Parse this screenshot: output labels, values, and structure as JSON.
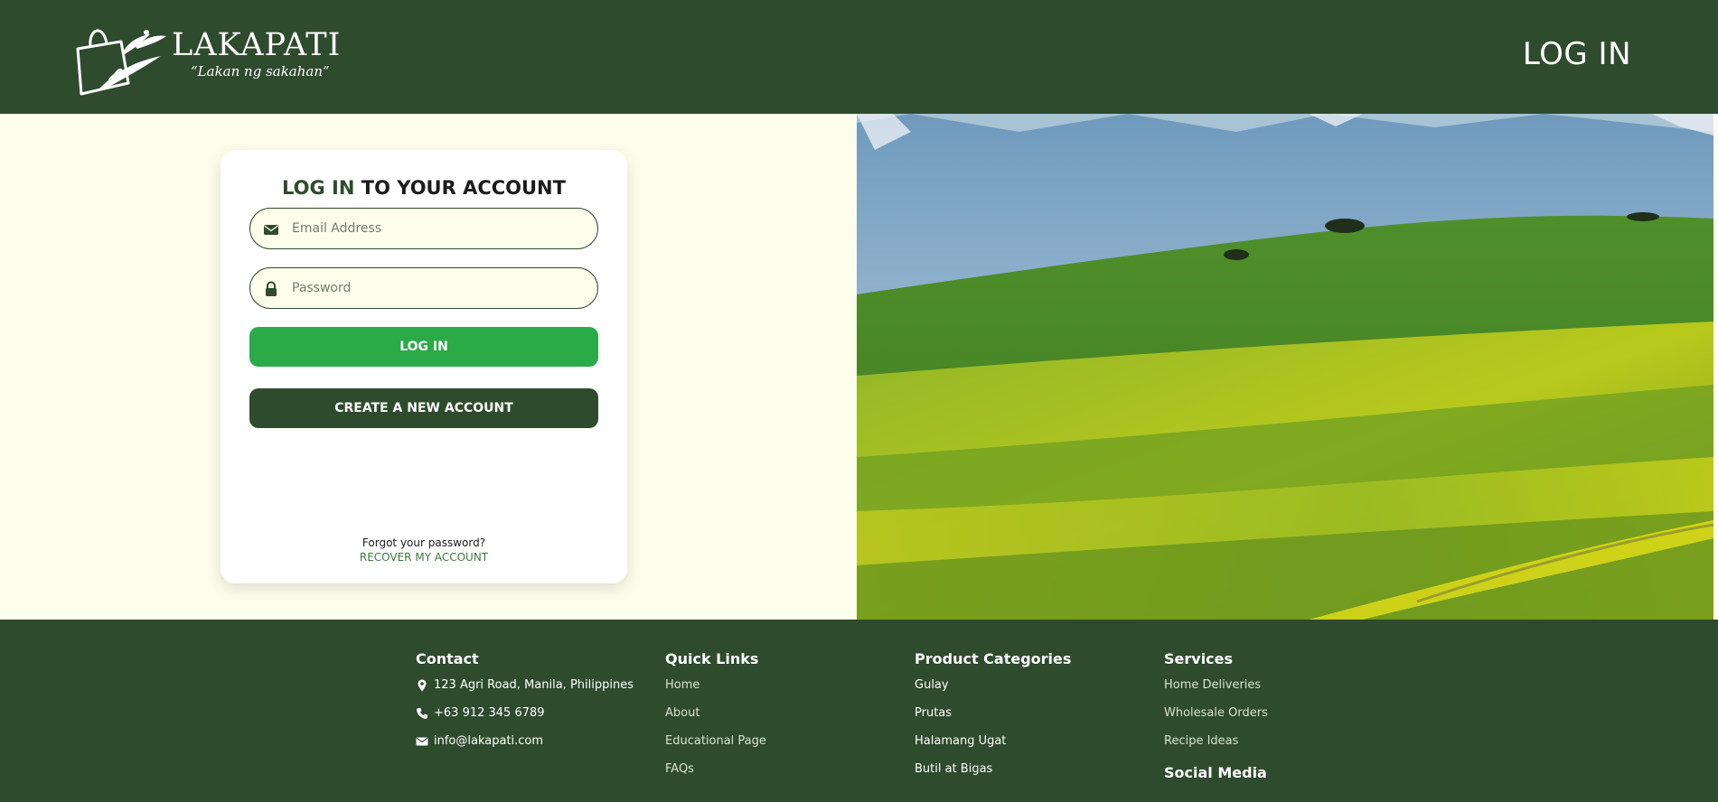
{
  "header": {
    "brand": "LAKAPATI",
    "tagline": "“Lakan ng sakahan”",
    "login_label": "LOG IN"
  },
  "login_card": {
    "title_accent": "LOG IN",
    "title_rest": " TO YOUR ACCOUNT",
    "email_placeholder": "Email Address",
    "password_placeholder": "Password",
    "login_button": "LOG IN",
    "create_button": "CREATE A NEW ACCOUNT",
    "forgot_text": "Forgot your password?",
    "recover_link": "RECOVER MY ACCOUNT"
  },
  "footer": {
    "contact": {
      "title": "Contact",
      "address": "123 Agri Road, Manila, Philippines",
      "phone": "+63 912 345 6789",
      "email": "info@lakapati.com"
    },
    "quick_links": {
      "title": "Quick Links",
      "items": [
        "Home",
        "About",
        "Educational Page",
        "FAQs"
      ]
    },
    "product_categories": {
      "title": "Product Categories",
      "items": [
        "Gulay",
        "Prutas",
        "Halamang Ugat",
        "Butil at Bigas"
      ]
    },
    "services": {
      "title": "Services",
      "items": [
        "Home Deliveries",
        "Wholesale Orders",
        "Recipe Ideas"
      ],
      "social_title": "Social Media"
    }
  },
  "colors": {
    "primary_dark_green": "#2f4b2e",
    "button_green": "#2aab48",
    "page_background": "#fdfdec"
  },
  "icons": {
    "email": "envelope-icon",
    "password": "lock-icon",
    "address": "map-pin-icon",
    "phone": "phone-icon",
    "contact_email": "envelope-icon"
  }
}
